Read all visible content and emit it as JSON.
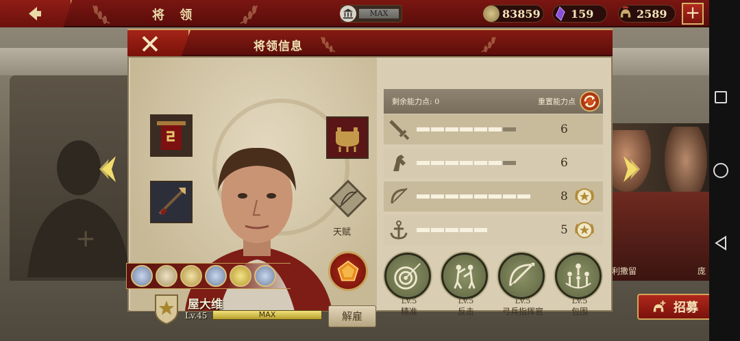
{
  "topbar": {
    "title": "将 领",
    "resources": {
      "capacity_label": "MAX",
      "coins": "83859",
      "gems": "159",
      "helmets": "2589"
    }
  },
  "background": {
    "neighbor_names": [
      "利撒留",
      "庞"
    ],
    "recruit_label": "招募"
  },
  "modal": {
    "title": "将领信息",
    "talent_label": "天赋",
    "hero": {
      "name": "屋大维",
      "level": "Lv.45",
      "exp_label": "MAX"
    },
    "dismiss_label": "解雇",
    "points": {
      "remaining_label": "剩余能力点: 0",
      "reset_label": "重置能力点"
    },
    "stats": [
      {
        "icon": "sword-icon",
        "value": "6",
        "segments_on": 6,
        "segments_total": 7,
        "star": false
      },
      {
        "icon": "horse-icon",
        "value": "6",
        "segments_on": 6,
        "segments_total": 7,
        "star": false
      },
      {
        "icon": "bow-icon",
        "value": "8",
        "segments_on": 8,
        "segments_total": 8,
        "star": true
      },
      {
        "icon": "anchor-icon",
        "value": "5",
        "segments_on": 5,
        "segments_total": 5,
        "star": true
      }
    ],
    "skills": [
      {
        "level": "Lv.5",
        "name": "精准",
        "icon": "target-arrow-icon"
      },
      {
        "level": "Lv.5",
        "name": "反击",
        "icon": "counter-attack-icon"
      },
      {
        "level": "Lv.5",
        "name": "弓兵指挥官",
        "icon": "bow-commander-icon"
      },
      {
        "level": "Lv.5",
        "name": "包围",
        "icon": "encircle-icon"
      }
    ]
  },
  "colors": {
    "header_red": "#7a1612",
    "gold_trim": "#c9a35a",
    "parchment": "#d9ceb3"
  }
}
